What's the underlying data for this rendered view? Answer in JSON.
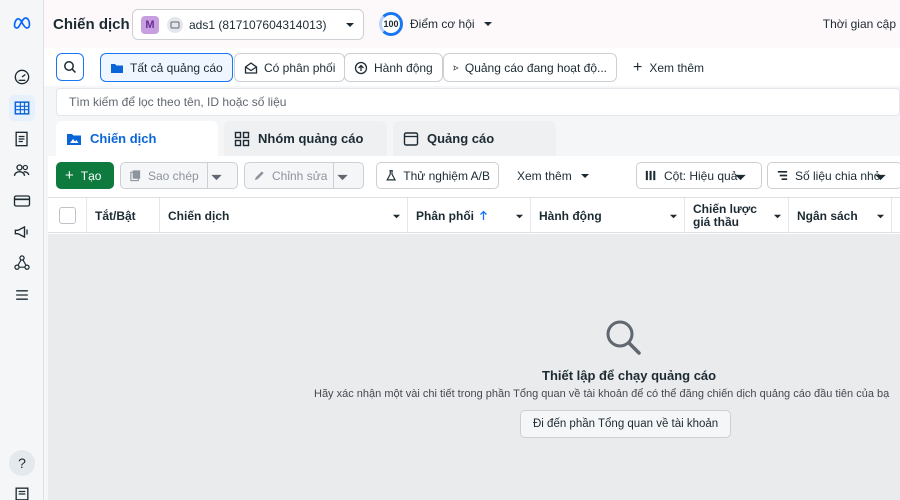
{
  "topbar": {
    "page_title": "Chiến dịch",
    "account_initial": "M",
    "account_name": "ads1 (817107604314013)",
    "score_value": "100",
    "score_label": "Điểm cơ hội",
    "time_label": "Thời gian cập"
  },
  "filters": {
    "chips": [
      {
        "label": "Tất cả quảng cáo"
      },
      {
        "label": "Có phân phối"
      },
      {
        "label": "Hành động"
      },
      {
        "label": "Quảng cáo đang hoạt độ..."
      }
    ],
    "more_label": "Xem thêm"
  },
  "search": {
    "placeholder": "Tìm kiếm để lọc theo tên, ID hoặc số liệu"
  },
  "tabs": [
    {
      "label": "Chiến dịch"
    },
    {
      "label": "Nhóm quảng cáo"
    },
    {
      "label": "Quảng cáo"
    }
  ],
  "toolbar": {
    "create_label": "Tạo",
    "copy_label": "Sao chép",
    "edit_label": "Chỉnh sửa",
    "ab_test_label": "Thử nghiệm A/B",
    "more_label": "Xem thêm",
    "columns_label": "Cột: Hiệu quả",
    "breakdown_label": "Số liệu chia nhỏ"
  },
  "table": {
    "columns": [
      {
        "label": "Tắt/Bật"
      },
      {
        "label": "Chiến dịch"
      },
      {
        "label": "Phân phối"
      },
      {
        "label": "Hành động"
      },
      {
        "label": "Chiến lược giá thầu"
      },
      {
        "label": "Ngân sách"
      }
    ]
  },
  "empty_state": {
    "title": "Thiết lập để chạy quảng cáo",
    "description": "Hãy xác nhận một vài chi tiết trong phần Tổng quan về tài khoản để có thể đăng chiến dịch quảng cáo đầu tiên của bạ",
    "button_label": "Đi đến phần Tổng quan về tài khoản"
  },
  "colors": {
    "accent": "#1877f2",
    "create_button": "#0f7a3e",
    "active_tab_text": "#0a66d8"
  }
}
